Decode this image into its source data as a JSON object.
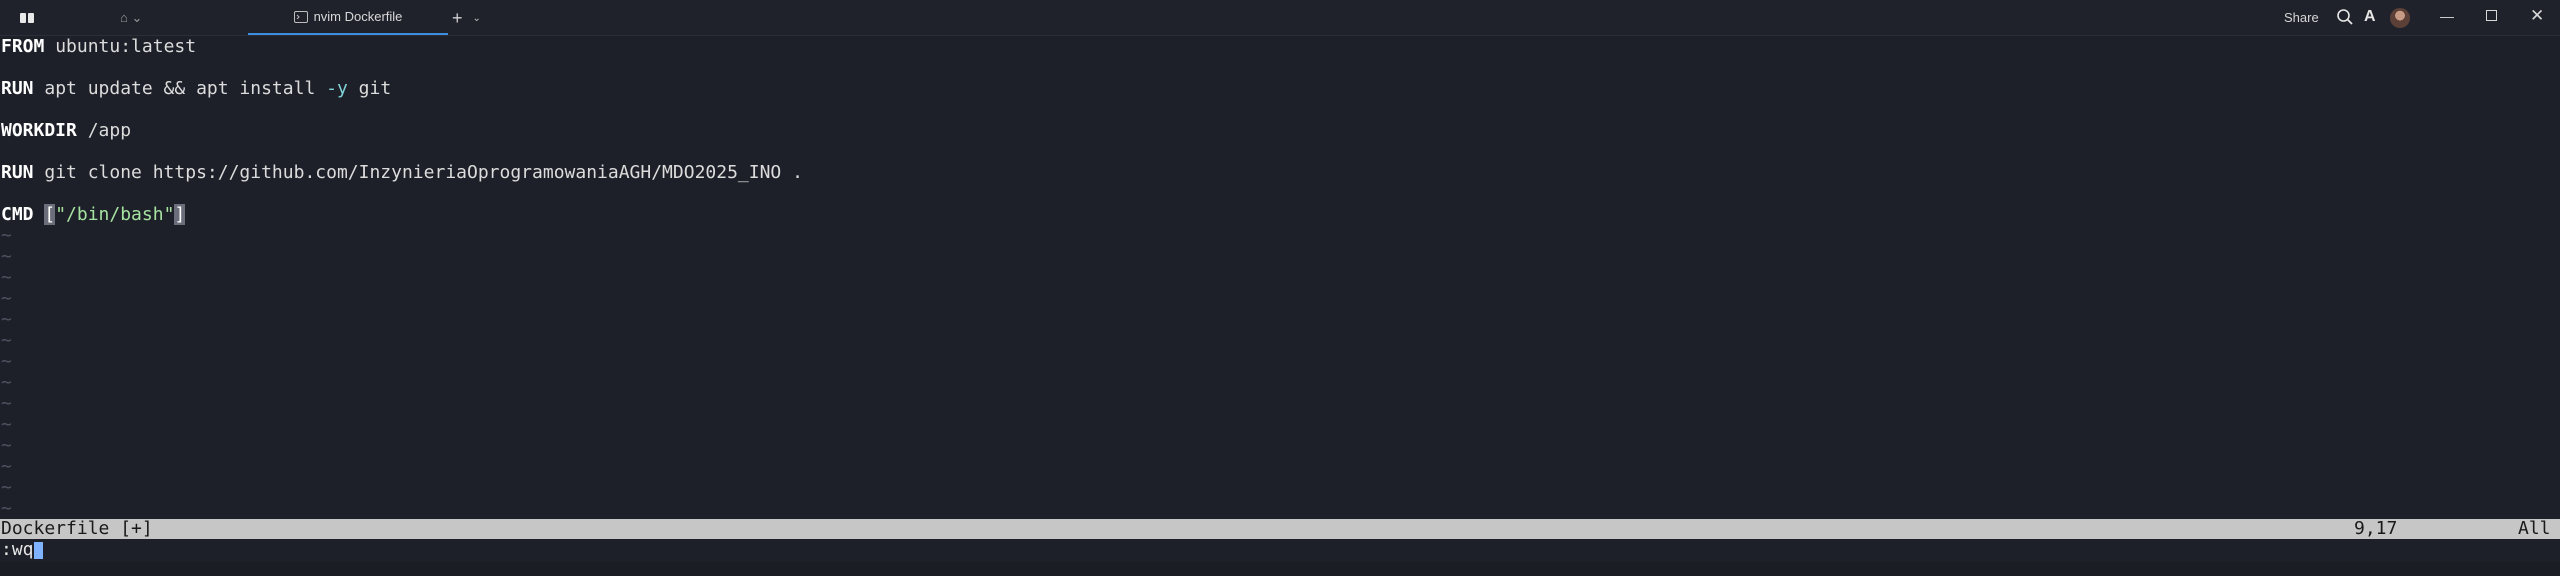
{
  "window": {
    "tab_inactive_label": "⌂ ⌄",
    "tab_active_title": "nvim Dockerfile",
    "new_tab_symbol": "+",
    "new_tab_dropdown": "⌄",
    "share_label": "Share",
    "font_icon_glyph": "A",
    "minimize_glyph": "—",
    "close_glyph": "✕"
  },
  "editor": {
    "lines": [
      {
        "kw": "FROM",
        "rest": " ubuntu:latest"
      },
      {
        "kw": "RUN",
        "pre": " apt update && apt install ",
        "flag": "-y",
        "post": " git"
      },
      {
        "kw": "WORKDIR",
        "rest": " /app"
      },
      {
        "kw": "RUN",
        "rest": " git clone https://github.com/InzynieriaOprogramowaniaAGH/MDO2025_INO ."
      },
      {
        "kw": "CMD",
        "space": " ",
        "open": "[",
        "str": "\"/bin/bash\"",
        "close": "]"
      }
    ],
    "tilde": "~"
  },
  "statusline": {
    "file": "Dockerfile [+]",
    "position": "9,17",
    "percent": "All"
  },
  "cmdline": {
    "text": ":wq"
  }
}
